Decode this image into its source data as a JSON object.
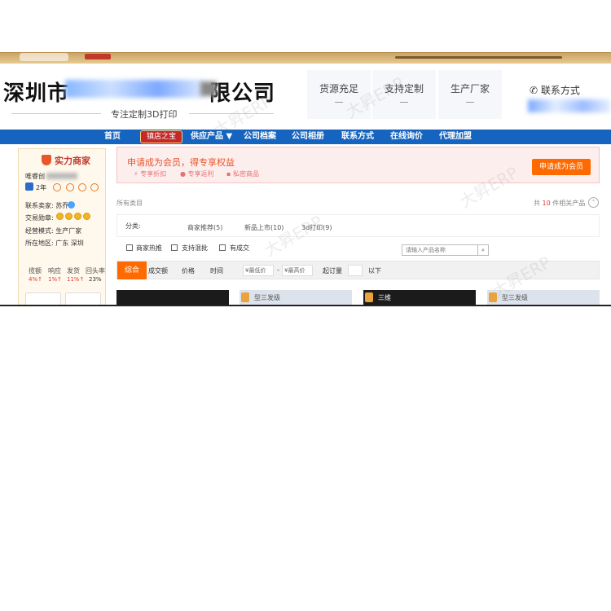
{
  "header": {
    "shop_name": "深圳市",
    "shop_name_suffix": "限公司",
    "tagline": "专注定制3D打印",
    "features": [
      "货源充足",
      "支持定制",
      "生产厂家"
    ],
    "contact_label": "联系方式"
  },
  "nav": {
    "items": [
      "首页",
      "镇店之宝",
      "供应产品 ▼",
      "公司档案",
      "公司相册",
      "联系方式",
      "在线询价",
      "代理加盟"
    ]
  },
  "sidebar": {
    "title": "实力商家",
    "shop_short": "唯睿创",
    "years": "2年",
    "contact_person_label": "联系卖家: 苏乔",
    "trade_medal_label": "交易勋章:",
    "business_model": "经营模式: 生产厂家",
    "region": "所在地区: 广东 深圳",
    "stats_headers": [
      "揽额",
      "响应",
      "发货",
      "回头率"
    ],
    "stats_values": [
      "4%↑",
      "1%↑",
      "11%↑",
      "23%"
    ]
  },
  "promo": {
    "title": "申请成为会员，得专享权益",
    "perks": [
      "专享折扣",
      "专享返利",
      "私密商品"
    ],
    "button": "申请成为会员"
  },
  "catalog": {
    "all_categories": "所有类目",
    "count_prefix": "共",
    "count_value": "10",
    "count_suffix": "件相关产品",
    "category_label": "分类:",
    "categories": [
      "商家推荐(5)",
      "新品上市(10)",
      "3d打印(9)"
    ]
  },
  "filters": {
    "checkboxes": [
      "商家热推",
      "支持混批",
      "有成交"
    ],
    "search_placeholder": "请输入产品名称"
  },
  "sort": {
    "items": [
      "综合",
      "成交额",
      "价格",
      "时间"
    ],
    "min_price": "¥最低价",
    "max_price": "¥最高价",
    "moq_label": "起订量",
    "below": "以下"
  },
  "cards": [
    {
      "label": "",
      "style": "dark"
    },
    {
      "label": "型三发级",
      "style": "light"
    },
    {
      "label": "三维",
      "style": "dark"
    },
    {
      "label": "型三发级",
      "style": "light"
    }
  ],
  "watermark": "大昇ERP",
  "colors": {
    "nav_blue": "#1565c0",
    "accent_orange": "#ff6a00",
    "promo_bg": "#fdeeee",
    "badge_red": "#c62828"
  }
}
